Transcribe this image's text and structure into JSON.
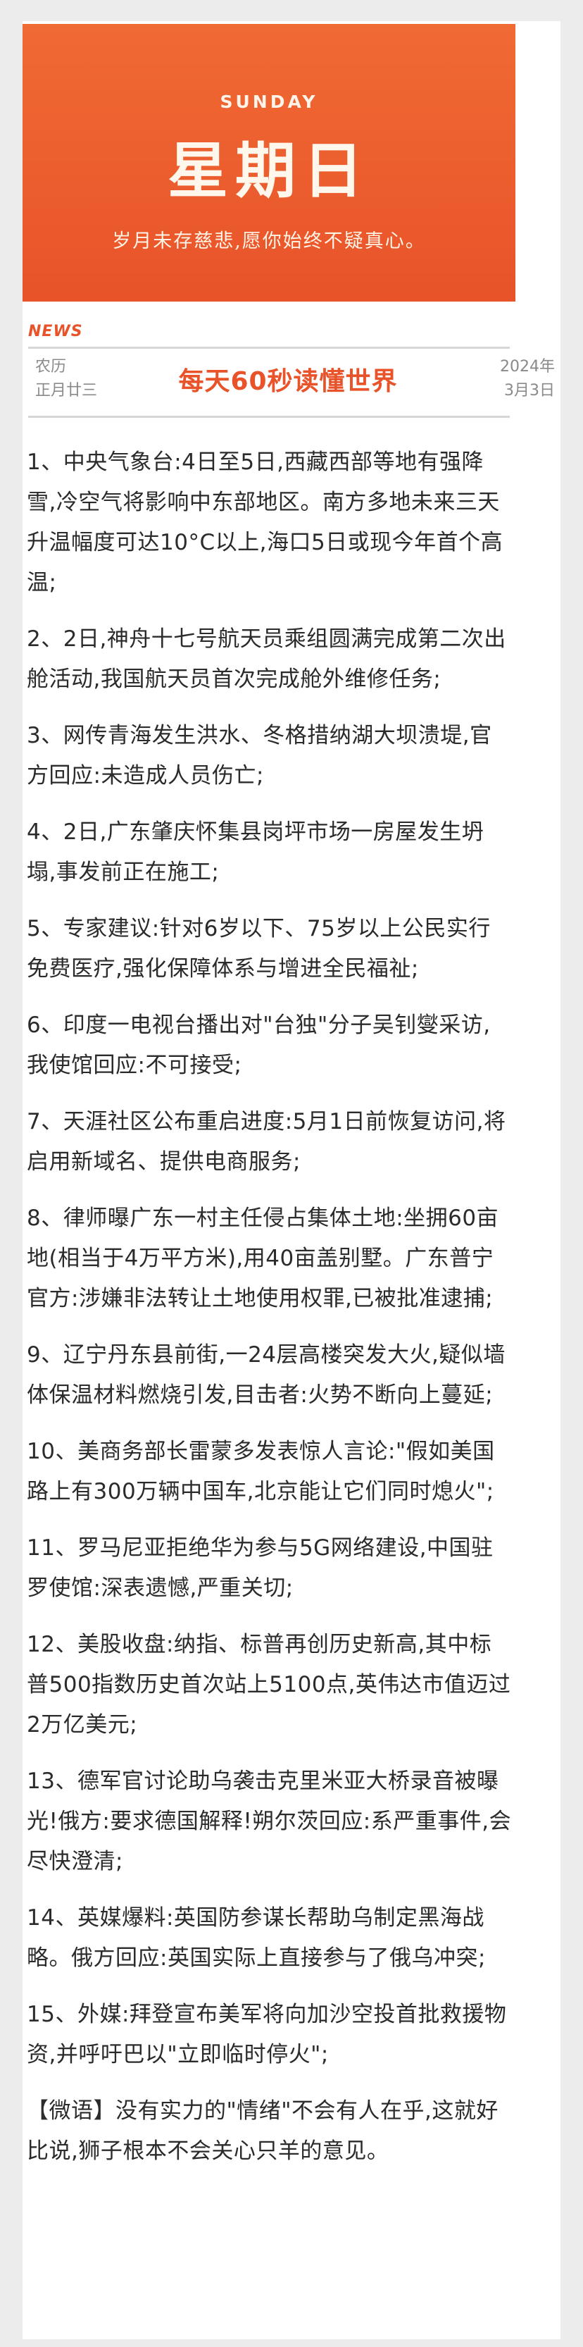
{
  "banner": {
    "day_en": "SUNDAY",
    "day_cn": "星期日",
    "motto": "岁月未存慈悲,愿你始终不疑真心。"
  },
  "header": {
    "news_label": "NEWS",
    "lunar_label": "农历",
    "lunar_date": "正月廿三",
    "masthead": "每天60秒读懂世界",
    "year": "2024年",
    "date": "3月3日"
  },
  "news": [
    "1、中央气象台:4日至5日,西藏西部等地有强降雪,冷空气将影响中东部地区。南方多地未来三天升温幅度可达10°C以上,海口5日或现今年首个高温;",
    "2、2日,神舟十七号航天员乘组圆满完成第二次出舱活动,我国航天员首次完成舱外维修任务;",
    "3、网传青海发生洪水、冬格措纳湖大坝溃堤,官方回应:未造成人员伤亡;",
    "4、2日,广东肇庆怀集县岗坪市场一房屋发生坍塌,事发前正在施工;",
    "5、专家建议:针对6岁以下、75岁以上公民实行免费医疗,强化保障体系与增进全民福祉;",
    "6、印度一电视台播出对\"台独\"分子吴钊燮采访,我使馆回应:不可接受;",
    "7、天涯社区公布重启进度:5月1日前恢复访问,将启用新域名、提供电商服务;",
    "8、律师曝广东一村主任侵占集体土地:坐拥60亩地(相当于4万平方米),用40亩盖别墅。广东普宁官方:涉嫌非法转让土地使用权罪,已被批准逮捕;",
    "9、辽宁丹东县前街,一24层高楼突发大火,疑似墙体保温材料燃烧引发,目击者:火势不断向上蔓延;",
    "10、美商务部长雷蒙多发表惊人言论:\"假如美国路上有300万辆中国车,北京能让它们同时熄火\";",
    "11、罗马尼亚拒绝华为参与5G网络建设,中国驻罗使馆:深表遗憾,严重关切;",
    "12、美股收盘:纳指、标普再创历史新高,其中标普500指数历史首次站上5100点,英伟达市值迈过2万亿美元;",
    "13、德军官讨论助乌袭击克里米亚大桥录音被曝光!俄方:要求德国解释!朔尔茨回应:系严重事件,会尽快澄清;",
    "14、英媒爆料:英国防参谋长帮助乌制定黑海战略。俄方回应:英国实际上直接参与了俄乌冲突;",
    "15、外媒:拜登宣布美军将向加沙空投首批救援物资,并呼吁巴以\"立即临时停火\";"
  ],
  "quote": "【微语】没有实力的\"情绪\"不会有人在乎,这就好比说,狮子根本不会关心只羊的意见。"
}
